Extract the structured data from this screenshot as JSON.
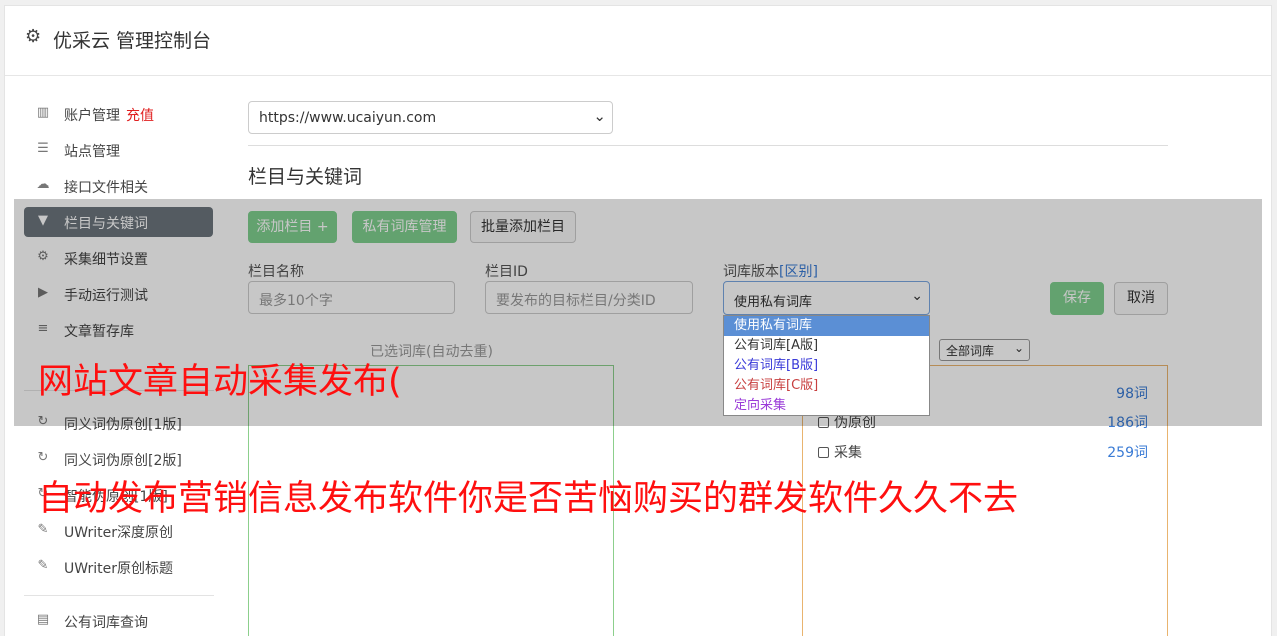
{
  "header": {
    "title": "优采云 管理控制台",
    "icon": "gear-icon"
  },
  "sidebar": {
    "items": [
      {
        "label": "账户管理",
        "extra": "充值",
        "icon": "bar-chart-icon"
      },
      {
        "label": "站点管理",
        "icon": "server-icon"
      },
      {
        "label": "接口文件相关",
        "icon": "cloud-upload-icon"
      },
      {
        "label": "栏目与关键词",
        "icon": "filter-icon",
        "active": true
      },
      {
        "label": "采集细节设置",
        "icon": "cogs-icon"
      },
      {
        "label": "手动运行测试",
        "icon": "play-circle-icon"
      },
      {
        "label": "文章暂存库",
        "icon": "database-icon"
      },
      {
        "label": "同义词伪原创[1版]",
        "icon": "refresh-icon"
      },
      {
        "label": "同义词伪原创[2版]",
        "icon": "refresh-icon"
      },
      {
        "label": "智能伪原创[1版]",
        "icon": "refresh-icon"
      },
      {
        "label": "UWriter深度原创",
        "icon": "edit-icon"
      },
      {
        "label": "UWriter原创标题",
        "icon": "edit-icon"
      },
      {
        "label": "公有词库查询",
        "icon": "book-icon"
      }
    ]
  },
  "site_select": {
    "value": "https://www.ucaiyun.com"
  },
  "section": {
    "title": "栏目与关键词"
  },
  "toolbar": {
    "add_column": "添加栏目 +",
    "private_lib": "私有词库管理",
    "batch_add": "批量添加栏目"
  },
  "form": {
    "name_label": "栏目名称",
    "name_placeholder": "最多10个字",
    "id_label": "栏目ID",
    "id_placeholder": "要发布的目标栏目/分类ID",
    "lib_label": "词库版本",
    "lib_link": "[区别]",
    "lib_value": "使用私有词库",
    "save": "保存",
    "cancel": "取消"
  },
  "lib_options": [
    {
      "label": "使用私有词库",
      "color": "#ffffff"
    },
    {
      "label": "公有词库[A版]",
      "color": "#333333"
    },
    {
      "label": "公有词库[B版]",
      "color": "#3a3ad8"
    },
    {
      "label": "公有词库[C版]",
      "color": "#c84040"
    },
    {
      "label": "定向采集",
      "color": "#9a3ad8"
    }
  ],
  "selected_box": {
    "caption": "已选词库(自动去重)"
  },
  "filter_select": {
    "value": "全部词库"
  },
  "libraries": [
    {
      "label": "",
      "count": "98词"
    },
    {
      "label": "伪原创",
      "count": "186词"
    },
    {
      "label": "采集",
      "count": "259词"
    }
  ],
  "overlay": {
    "line1": "网站文章自动采集发布(",
    "line2": "自动发布营销信息发布软件你是否苦恼购买的群发软件久久不去"
  }
}
